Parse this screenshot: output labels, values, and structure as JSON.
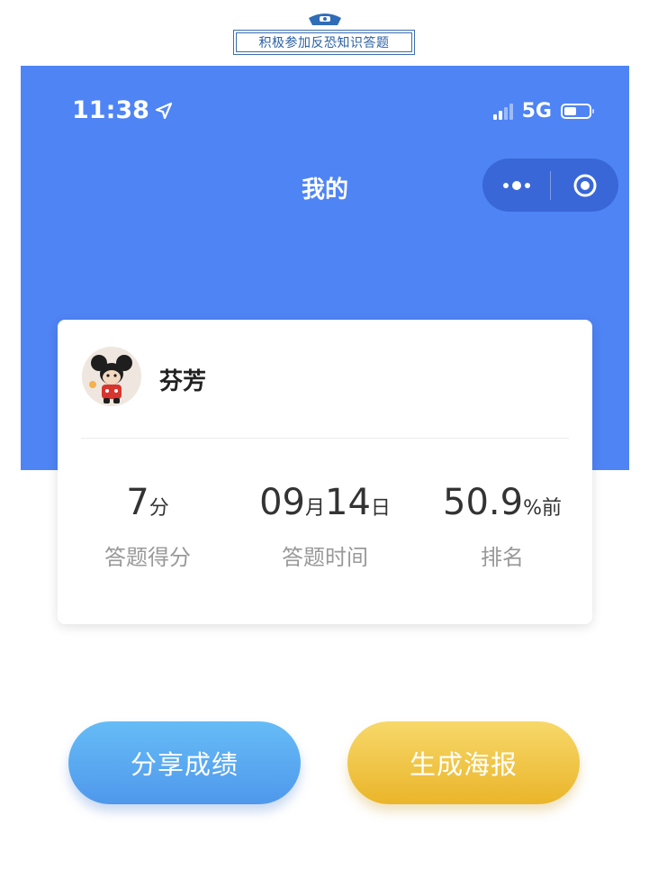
{
  "caption": {
    "text": "积极参加反恐知识答题"
  },
  "status_bar": {
    "time": "11:38",
    "network": "5G"
  },
  "nav": {
    "title": "我的"
  },
  "profile": {
    "name": "芬芳"
  },
  "stats": [
    {
      "value": "7",
      "unit": "分",
      "label": "答题得分"
    },
    {
      "month": "09",
      "month_unit": "月",
      "day": "14",
      "day_unit": "日",
      "label": "答题时间"
    },
    {
      "value": "50.9",
      "unit": "%前",
      "label": "排名"
    }
  ],
  "buttons": {
    "share": "分享成绩",
    "poster": "生成海报"
  },
  "colors": {
    "header_blue": "#4f84f5",
    "share_button": "#5aa9f1",
    "poster_button": "#efc441",
    "caption_blue": "#2a5fa3"
  }
}
